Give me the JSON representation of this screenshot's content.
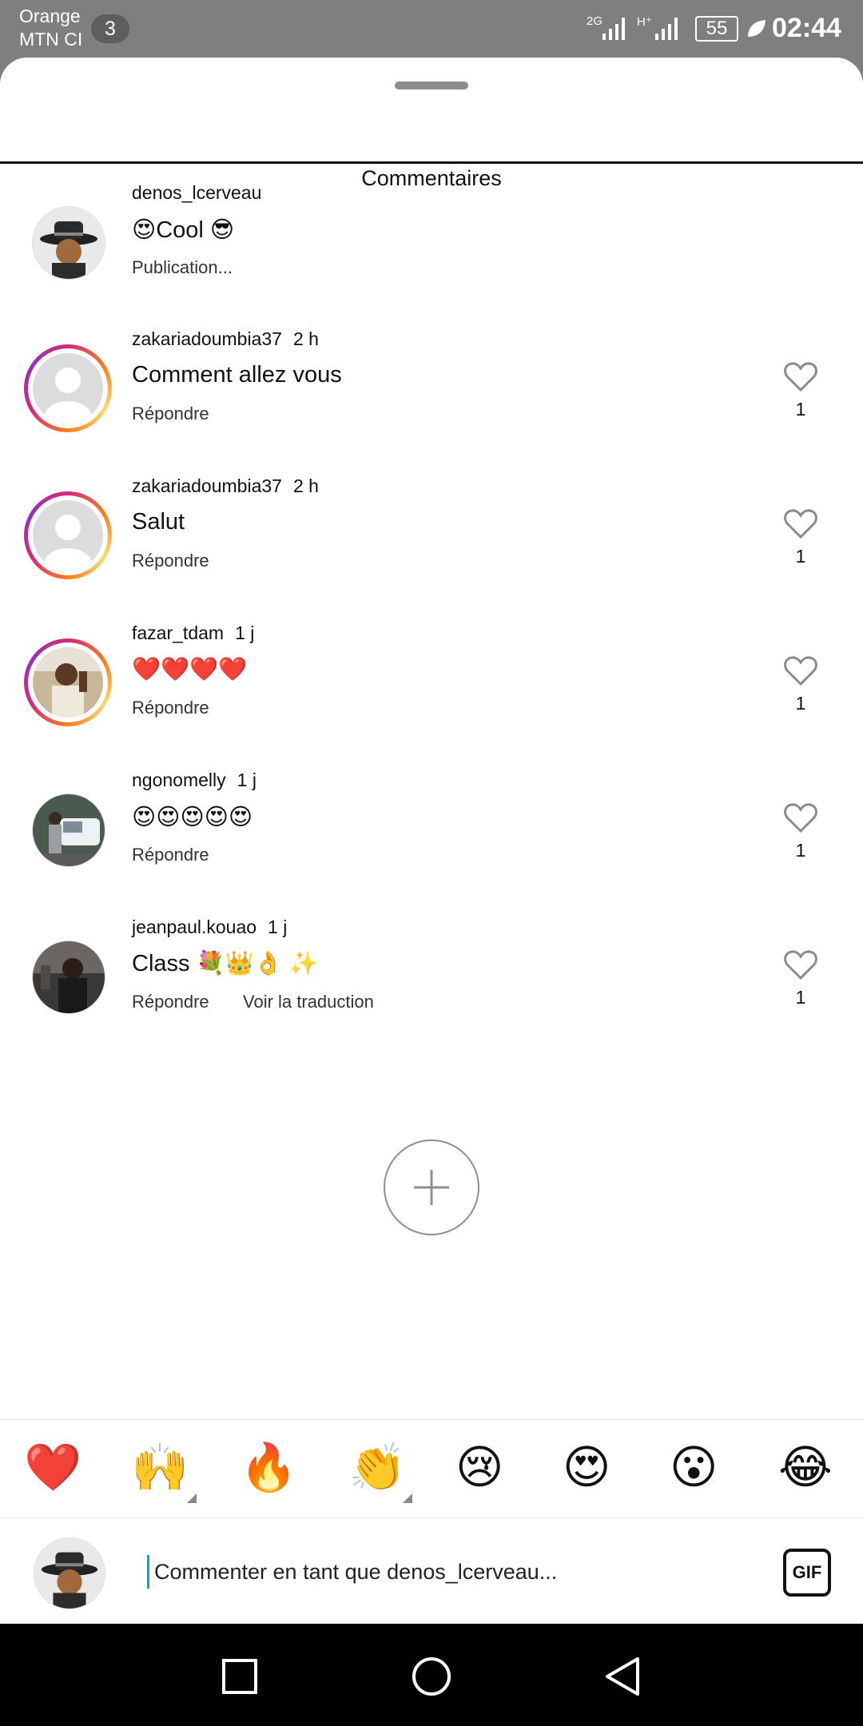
{
  "status_bar": {
    "carrier_line1": "Orange",
    "carrier_line2": "MTN CI",
    "notification_count": "3",
    "network_1": "2G",
    "network_2": "H⁺",
    "battery": "55",
    "time": "02:44"
  },
  "header": {
    "title": "Commentaires"
  },
  "caption": {
    "username": "denos_lcerveau",
    "text": "😍Cool 😎",
    "meta": "Publication..."
  },
  "comments": [
    {
      "username": "zakariadoumbia37",
      "time": "2 h",
      "text": "Comment allez vous",
      "reply": "Répondre",
      "likes": "1"
    },
    {
      "username": "zakariadoumbia37",
      "time": "2 h",
      "text": "Salut",
      "reply": "Répondre",
      "likes": "1"
    },
    {
      "username": "fazar_tdam",
      "time": "1 j",
      "text": "❤️❤️❤️❤️",
      "reply": "Répondre",
      "likes": "1"
    },
    {
      "username": "ngonomelly",
      "time": "1 j",
      "text": "😍😍😍😍😍",
      "reply": "Répondre",
      "likes": "1"
    },
    {
      "username": "jeanpaul.kouao",
      "time": "1 j",
      "text": "Class 💐👑👌 ✨",
      "reply": "Répondre",
      "translate": "Voir la traduction",
      "likes": "1"
    }
  ],
  "quick_reactions": [
    "❤️",
    "🙌",
    "🔥",
    "👏",
    "😢",
    "😍",
    "😮",
    "😂"
  ],
  "composer": {
    "placeholder": "Commenter en tant que denos_lcerveau...",
    "gif_label": "GIF"
  },
  "icons": {
    "like": "heart-outline-icon",
    "load_more": "plus-circle-icon",
    "nav": [
      "recent-apps-icon",
      "home-icon",
      "back-icon"
    ]
  },
  "colors": {
    "story_ring_start": "#d62976",
    "story_ring_end": "#fa7e1e",
    "text": "#111111"
  }
}
